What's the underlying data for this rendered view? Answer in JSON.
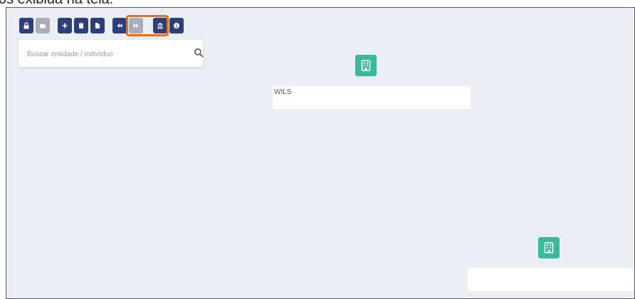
{
  "caption": "os exibida na tela.",
  "toolbar": {
    "buttons": [
      {
        "icon": "lock-icon",
        "state": "active"
      },
      {
        "icon": "folder-icon",
        "state": "disabled"
      },
      {
        "icon": "plus-icon",
        "state": "active"
      },
      {
        "icon": "trash-icon",
        "state": "active"
      },
      {
        "icon": "document-icon",
        "state": "active"
      },
      {
        "icon": "undo-icon",
        "state": "active"
      },
      {
        "icon": "redo-icon",
        "state": "disabled"
      },
      {
        "icon": "bank-icon",
        "state": "active"
      },
      {
        "icon": "info-icon",
        "state": "active"
      }
    ],
    "highlight_color": "#ea6e16"
  },
  "search": {
    "placeholder": "Buscar entidade / indivíduo"
  },
  "nodes": [
    {
      "icon": "building-icon",
      "label": "WILS"
    },
    {
      "icon": "building-icon",
      "label": ""
    }
  ],
  "colors": {
    "canvas": "#eceef5",
    "toolbar_button": "#2d3f79",
    "toolbar_button_disabled": "#a9adb8",
    "node": "#3cb89a"
  }
}
